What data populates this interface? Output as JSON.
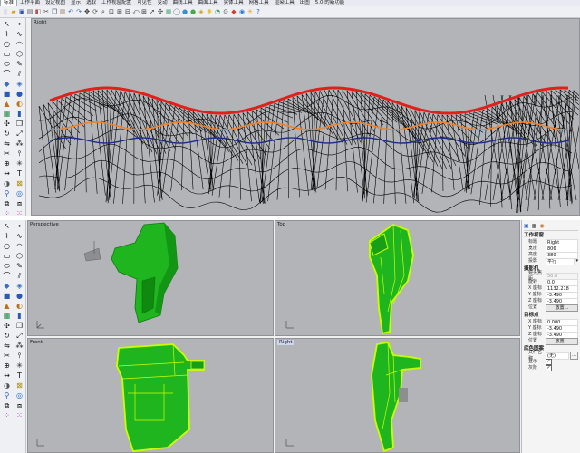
{
  "menu_tabs": [
    "标准",
    "工作平面",
    "设定视图",
    "显示",
    "选取",
    "工作视窗配置",
    "可见性",
    "变动",
    "曲线工具",
    "曲面工具",
    "实体工具",
    "网格工具",
    "渲染工具",
    "出图",
    "5.0 的新功能"
  ],
  "top_viewport": {
    "label": "Right"
  },
  "viewports": {
    "perspective": {
      "label": "Perspective"
    },
    "top": {
      "label": "Top"
    },
    "front": {
      "label": "Front"
    },
    "right": {
      "label": "Right"
    }
  },
  "properties": {
    "viewport_section": "工作视窗",
    "title_label": "标题",
    "title_value": "Right",
    "width_label": "宽度",
    "width_value": "806",
    "height_label": "高度",
    "height_value": "380",
    "projection_label": "投影",
    "projection_value": "平行",
    "camera_section": "摄影机",
    "lens_label": "镜头焦距",
    "lens_value": "50.0",
    "rotation_label": "旋转",
    "rotation_value": "0.0",
    "cam_x_label": "X 座标",
    "cam_x_value": "1132.218",
    "cam_y_label": "Y 座标",
    "cam_y_value": "-3.490",
    "cam_z_label": "Z 座标",
    "cam_z_value": "-3.490",
    "cam_pos_label": "位置",
    "cam_pos_button": "放置...",
    "target_section": "目标点",
    "tgt_x_label": "X 座标",
    "tgt_x_value": "0.000",
    "tgt_y_label": "Y 座标",
    "tgt_y_value": "-3.490",
    "tgt_z_label": "Z 座标",
    "tgt_z_value": "-3.490",
    "tgt_pos_label": "位置",
    "tgt_pos_button": "放置...",
    "wallpaper_section": "底色图案",
    "filename_label": "文件名称",
    "filename_value": "(无)",
    "show_label": "显示",
    "gray_label": "灰阶"
  },
  "colors": {
    "viewport_bg": "#b3b4b7",
    "object_green": "#1fb51f",
    "highlight": "#c8ff00",
    "red_curve": "#e0201a",
    "orange_curve": "#f0832a",
    "blue_curve": "#1a2c8a"
  }
}
